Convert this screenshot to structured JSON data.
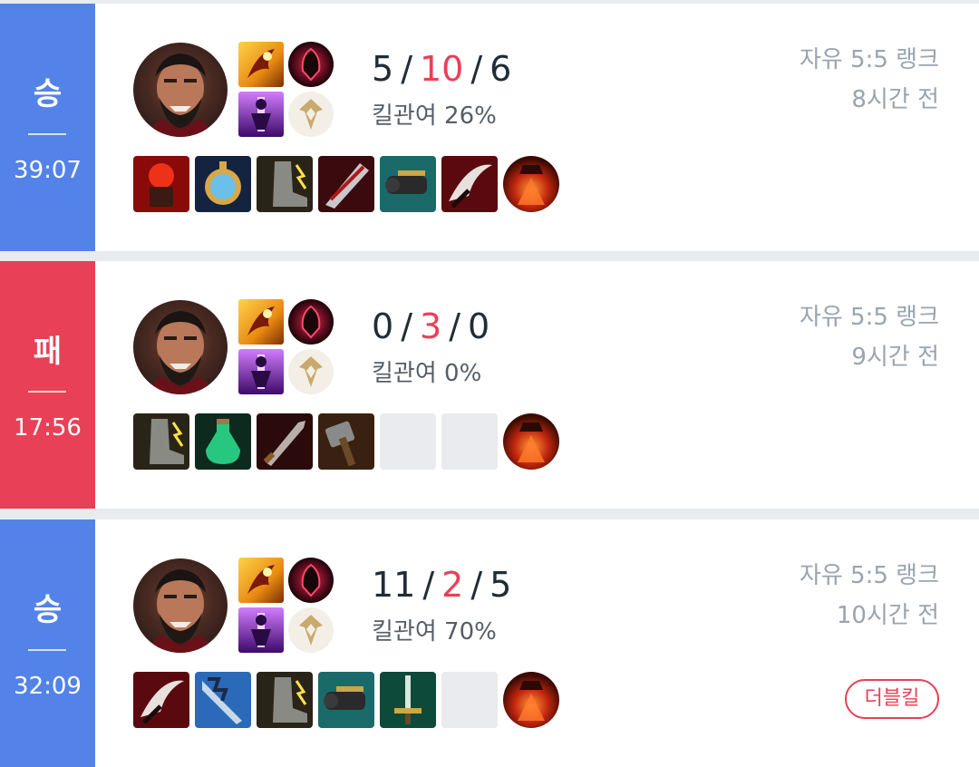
{
  "colors": {
    "win": "#5383e8",
    "loss": "#e84057",
    "deaths": "#e84057",
    "background": "#e9ebee"
  },
  "matches": [
    {
      "result": "승",
      "duration": "39:07",
      "kills": "5",
      "deaths": "10",
      "assists": "6",
      "kill_participation": "킬관여 26%",
      "queue": "자유 5:5 랭크",
      "time_ago": "8시간 전",
      "champion_icon": "champion-portrait-icon",
      "spells": [
        "ignite-spell-icon",
        "flash-spell-icon"
      ],
      "runes": [
        "dark-harvest-rune-icon",
        "precision-rune-icon"
      ],
      "items": [
        "red-item-icon",
        "stopwatch-item-icon",
        "boots-item-icon",
        "blade-item-icon",
        "cannon-item-icon",
        "scythe-item-icon"
      ],
      "trinket": "oracle-lens-icon",
      "badge": ""
    },
    {
      "result": "패",
      "duration": "17:56",
      "kills": "0",
      "deaths": "3",
      "assists": "0",
      "kill_participation": "킬관여 0%",
      "queue": "자유 5:5 랭크",
      "time_ago": "9시간 전",
      "champion_icon": "champion-portrait-icon",
      "spells": [
        "ignite-spell-icon",
        "flash-spell-icon"
      ],
      "runes": [
        "dark-harvest-rune-icon",
        "precision-rune-icon"
      ],
      "items": [
        "boots-item-icon",
        "potion-item-icon",
        "dagger-item-icon",
        "hammer-item-icon",
        "",
        ""
      ],
      "trinket": "oracle-lens-icon",
      "badge": ""
    },
    {
      "result": "승",
      "duration": "32:09",
      "kills": "11",
      "deaths": "2",
      "assists": "5",
      "kill_participation": "킬관여 70%",
      "queue": "자유 5:5 랭크",
      "time_ago": "10시간 전",
      "champion_icon": "champion-portrait-icon",
      "spells": [
        "ignite-spell-icon",
        "flash-spell-icon"
      ],
      "runes": [
        "dark-harvest-rune-icon",
        "precision-rune-icon"
      ],
      "items": [
        "scythe-item-icon",
        "tower-blade-item-icon",
        "boots-item-icon",
        "cannon-item-icon",
        "sword-item-icon",
        ""
      ],
      "trinket": "oracle-lens-icon",
      "badge": "더블킬"
    }
  ]
}
